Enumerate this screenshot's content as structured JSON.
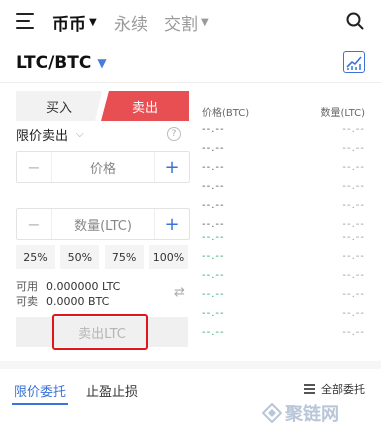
{
  "nav": {
    "tabs": [
      {
        "label": "币币",
        "active": true
      },
      {
        "label": "永续",
        "active": false
      },
      {
        "label": "交割",
        "active": false
      }
    ]
  },
  "pair": {
    "symbol": "LTC/BTC"
  },
  "trade": {
    "buy_label": "买入",
    "sell_label": "卖出",
    "order_type": "限价卖出",
    "price_placeholder": "价格",
    "quantity_placeholder": "数量(LTC)",
    "percentages": [
      "25%",
      "50%",
      "75%",
      "100%"
    ],
    "available_label": "可用",
    "available_value": "0.000000 LTC",
    "sellable_label": "可卖",
    "sellable_value": "0.0000 BTC",
    "submit_label": "卖出LTC"
  },
  "orderbook": {
    "price_header": "价格(BTC)",
    "qty_header": "数量(LTC)",
    "asks": [
      {
        "price": "--.--",
        "qty": "--.--"
      },
      {
        "price": "--.--",
        "qty": "--.--"
      },
      {
        "price": "--.--",
        "qty": "--.--"
      },
      {
        "price": "--.--",
        "qty": "--.--"
      },
      {
        "price": "--.--",
        "qty": "--.--"
      },
      {
        "price": "--.--",
        "qty": "--.--"
      }
    ],
    "bids": [
      {
        "price": "--.--",
        "qty": "--.--"
      },
      {
        "price": "--.--",
        "qty": "--.--"
      },
      {
        "price": "--.--",
        "qty": "--.--"
      },
      {
        "price": "--.--",
        "qty": "--.--"
      },
      {
        "price": "--.--",
        "qty": "--.--"
      },
      {
        "price": "--.--",
        "qty": "--.--"
      }
    ]
  },
  "bottom_tabs": {
    "open_orders": "限价委托",
    "stop_orders": "止盈止损",
    "all_orders": "全部委托"
  },
  "watermark": {
    "text": "聚链网"
  },
  "colors": {
    "accent": "#3b73d6",
    "sell": "#e84f52",
    "bid": "#2aa56c",
    "highlight": "#e0161a"
  }
}
